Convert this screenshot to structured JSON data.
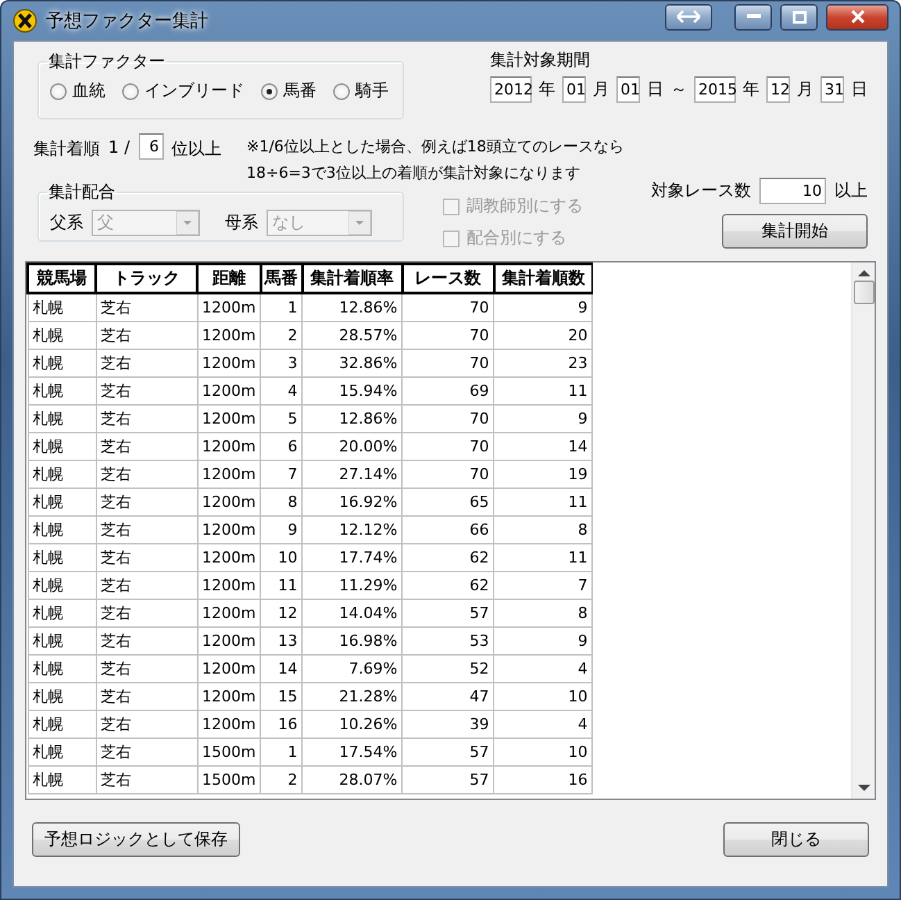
{
  "window": {
    "title": "予想ファクター集計"
  },
  "factor_group": {
    "title": "集計ファクター",
    "options": [
      {
        "label": "血統",
        "selected": false
      },
      {
        "label": "インブリード",
        "selected": false
      },
      {
        "label": "馬番",
        "selected": true
      },
      {
        "label": "騎手",
        "selected": false
      }
    ]
  },
  "period": {
    "label": "集計対象期間",
    "parts": [
      {
        "kind": "input",
        "value": "2012"
      },
      {
        "kind": "text",
        "value": "年"
      },
      {
        "kind": "input",
        "value": "01"
      },
      {
        "kind": "text",
        "value": "月"
      },
      {
        "kind": "input",
        "value": "01"
      },
      {
        "kind": "text",
        "value": "日"
      },
      {
        "kind": "text",
        "value": "～"
      },
      {
        "kind": "input",
        "value": "2015"
      },
      {
        "kind": "text",
        "value": "年"
      },
      {
        "kind": "input",
        "value": "12"
      },
      {
        "kind": "text",
        "value": "月"
      },
      {
        "kind": "input",
        "value": "31"
      },
      {
        "kind": "text",
        "value": "日"
      }
    ]
  },
  "rank": {
    "label": "集計着順",
    "prefix": "1 /",
    "value": "6",
    "suffix": "位以上",
    "note": [
      "※1/6位以上とした場合、例えば18頭立てのレースなら",
      "18÷6=3で3位以上の着順が集計対象になります"
    ]
  },
  "pairing_group": {
    "title": "集計配合",
    "fields": [
      {
        "label": "父系",
        "value": "父",
        "disabled": true
      },
      {
        "label": "母系",
        "value": "なし",
        "disabled": true
      }
    ]
  },
  "checkboxes": [
    {
      "label": "調教師別にする",
      "checked": false,
      "disabled": true
    },
    {
      "label": "配合別にする",
      "checked": false,
      "disabled": true
    }
  ],
  "race_count": {
    "label": "対象レース数",
    "value": "10",
    "suffix": "以上"
  },
  "start_button": "集計開始",
  "table": {
    "columns": [
      "競馬場",
      "トラック",
      "距離",
      "馬番",
      "集計着順率",
      "レース数",
      "集計着順数"
    ],
    "rows": [
      [
        "札幌",
        "芝右",
        "1200m",
        "1",
        "12.86%",
        "70",
        "9"
      ],
      [
        "札幌",
        "芝右",
        "1200m",
        "2",
        "28.57%",
        "70",
        "20"
      ],
      [
        "札幌",
        "芝右",
        "1200m",
        "3",
        "32.86%",
        "70",
        "23"
      ],
      [
        "札幌",
        "芝右",
        "1200m",
        "4",
        "15.94%",
        "69",
        "11"
      ],
      [
        "札幌",
        "芝右",
        "1200m",
        "5",
        "12.86%",
        "70",
        "9"
      ],
      [
        "札幌",
        "芝右",
        "1200m",
        "6",
        "20.00%",
        "70",
        "14"
      ],
      [
        "札幌",
        "芝右",
        "1200m",
        "7",
        "27.14%",
        "70",
        "19"
      ],
      [
        "札幌",
        "芝右",
        "1200m",
        "8",
        "16.92%",
        "65",
        "11"
      ],
      [
        "札幌",
        "芝右",
        "1200m",
        "9",
        "12.12%",
        "66",
        "8"
      ],
      [
        "札幌",
        "芝右",
        "1200m",
        "10",
        "17.74%",
        "62",
        "11"
      ],
      [
        "札幌",
        "芝右",
        "1200m",
        "11",
        "11.29%",
        "62",
        "7"
      ],
      [
        "札幌",
        "芝右",
        "1200m",
        "12",
        "14.04%",
        "57",
        "8"
      ],
      [
        "札幌",
        "芝右",
        "1200m",
        "13",
        "16.98%",
        "53",
        "9"
      ],
      [
        "札幌",
        "芝右",
        "1200m",
        "14",
        "7.69%",
        "52",
        "4"
      ],
      [
        "札幌",
        "芝右",
        "1200m",
        "15",
        "21.28%",
        "47",
        "10"
      ],
      [
        "札幌",
        "芝右",
        "1200m",
        "16",
        "10.26%",
        "39",
        "4"
      ],
      [
        "札幌",
        "芝右",
        "1500m",
        "1",
        "17.54%",
        "57",
        "10"
      ],
      [
        "札幌",
        "芝右",
        "1500m",
        "2",
        "28.07%",
        "57",
        "16"
      ]
    ]
  },
  "footer_buttons": [
    "予想ロジックとして保存",
    "閉じる"
  ]
}
